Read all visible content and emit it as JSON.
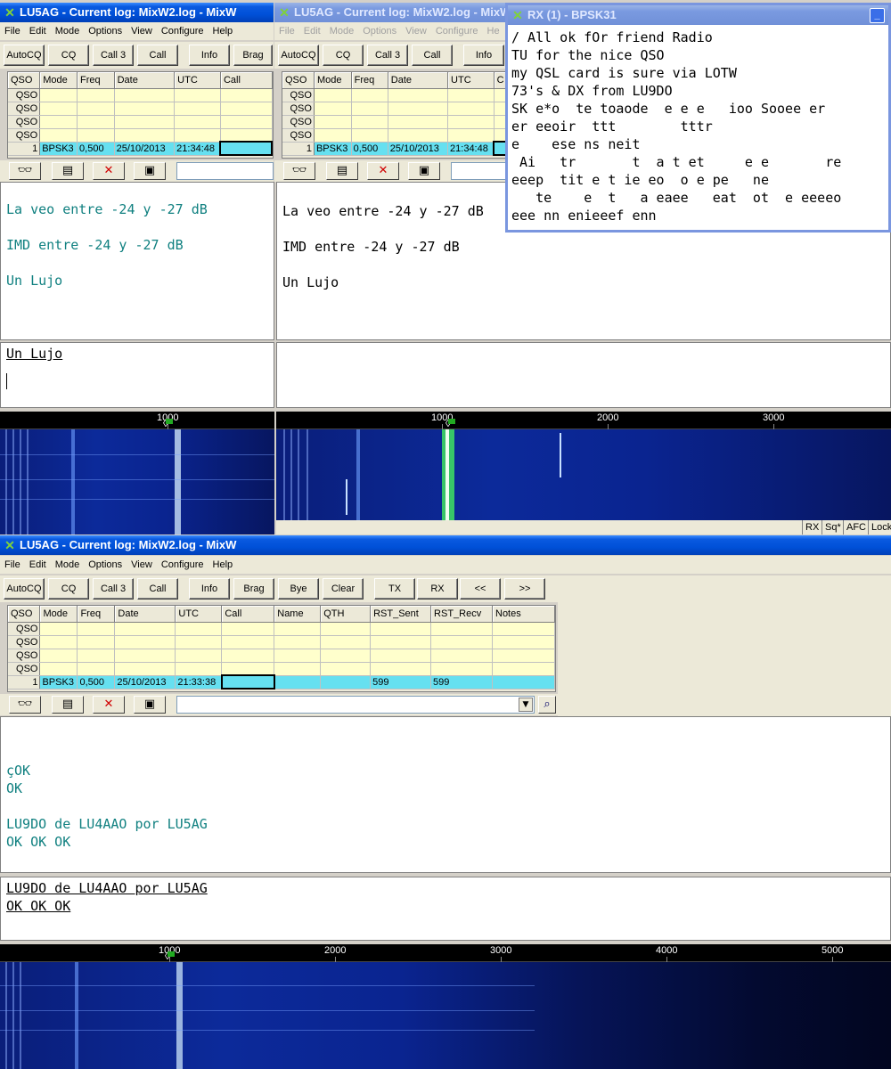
{
  "colors": {
    "title_active": "#0050d8",
    "rx_text": "#108080",
    "grid_row": "#ffffcc",
    "grid_current": "#66e0f0"
  },
  "window_left": {
    "title": "LU5AG - Current log: MixW2.log - MixW",
    "menu": [
      "File",
      "Edit",
      "Mode",
      "Options",
      "View",
      "Configure",
      "Help"
    ],
    "buttons": [
      "AutoCQ",
      "CQ",
      "Call 3",
      "Call",
      "Info",
      "Brag"
    ],
    "columns": [
      "QSO",
      "Mode",
      "Freq",
      "Date",
      "UTC",
      "Call"
    ],
    "current_row": {
      "num": "1",
      "mode": "BPSK3",
      "freq": "0,500",
      "date": "25/10/2013",
      "utc": "21:34:48"
    },
    "rx_lines": [
      "La veo entre -24 y -27 dB",
      "",
      "IMD entre -24 y -27 dB",
      "",
      "Un Lujo"
    ],
    "tx_text": "Un Lujo",
    "wf_label": "1000"
  },
  "window_mid": {
    "title": "LU5AG - Current log: MixW2.log - MixW",
    "menu": [
      "File",
      "Edit",
      "Mode",
      "Options",
      "View",
      "Configure",
      "He"
    ],
    "buttons": [
      "AutoCQ",
      "CQ",
      "Call 3",
      "Call",
      "Info"
    ],
    "columns": [
      "QSO",
      "Mode",
      "Freq",
      "Date",
      "UTC",
      "C"
    ],
    "current_row": {
      "num": "1",
      "mode": "BPSK3",
      "freq": "0,500",
      "date": "25/10/2013",
      "utc": "21:34:48"
    },
    "rx_lines": [
      "La veo entre -24 y -27 dB",
      "",
      "IMD entre -24 y -27 dB",
      "",
      "Un Lujo"
    ],
    "wf_labels": [
      "1000",
      "2000",
      "3000"
    ],
    "status": [
      "RX",
      "Sq*",
      "AFC",
      "Lock"
    ]
  },
  "rx_window": {
    "title": "RX (1) - BPSK31",
    "lines": [
      "/ All ok fOr friend Radio",
      "TU for the nice QSO",
      "my QSL card is sure via LOTW",
      "73's & DX from LU9DO",
      "SK e*o  te toaode  e e e   ioo Sooee er",
      "er eeoir  ttt        tttr",
      "e    ese ns neit",
      " Ai   tr       t  a t et     e e       re",
      "eeep  tit e t ie eo  o e pe   ne",
      "   te    e  t   a eaee   eat  ot  e eeeeo",
      "eee nn enieeef enn"
    ]
  },
  "window_main": {
    "title": "LU5AG - Current log: MixW2.log - MixW",
    "menu": [
      "File",
      "Edit",
      "Mode",
      "Options",
      "View",
      "Configure",
      "Help"
    ],
    "buttons": [
      "AutoCQ",
      "CQ",
      "Call 3",
      "Call",
      "Info",
      "Brag",
      "Bye",
      "Clear",
      "TX",
      "RX",
      "<<",
      ">>"
    ],
    "columns": [
      "QSO",
      "Mode",
      "Freq",
      "Date",
      "UTC",
      "Call",
      "Name",
      "QTH",
      "RST_Sent",
      "RST_Recv",
      "Notes"
    ],
    "current_row": {
      "num": "1",
      "mode": "BPSK3",
      "freq": "0,500",
      "date": "25/10/2013",
      "utc": "21:33:38",
      "rst_sent": "599",
      "rst_recv": "599"
    },
    "rx_lines": [
      "",
      "",
      "çOK",
      "OK",
      "",
      "LU9DO de LU4AAO por LU5AG",
      "OK OK OK"
    ],
    "tx_lines": [
      "LU9DO de LU4AAO por LU5AG",
      "OK OK OK"
    ],
    "wf_labels": [
      "1000",
      "2000",
      "3000",
      "4000",
      "5000"
    ]
  },
  "row_label": "QSO"
}
